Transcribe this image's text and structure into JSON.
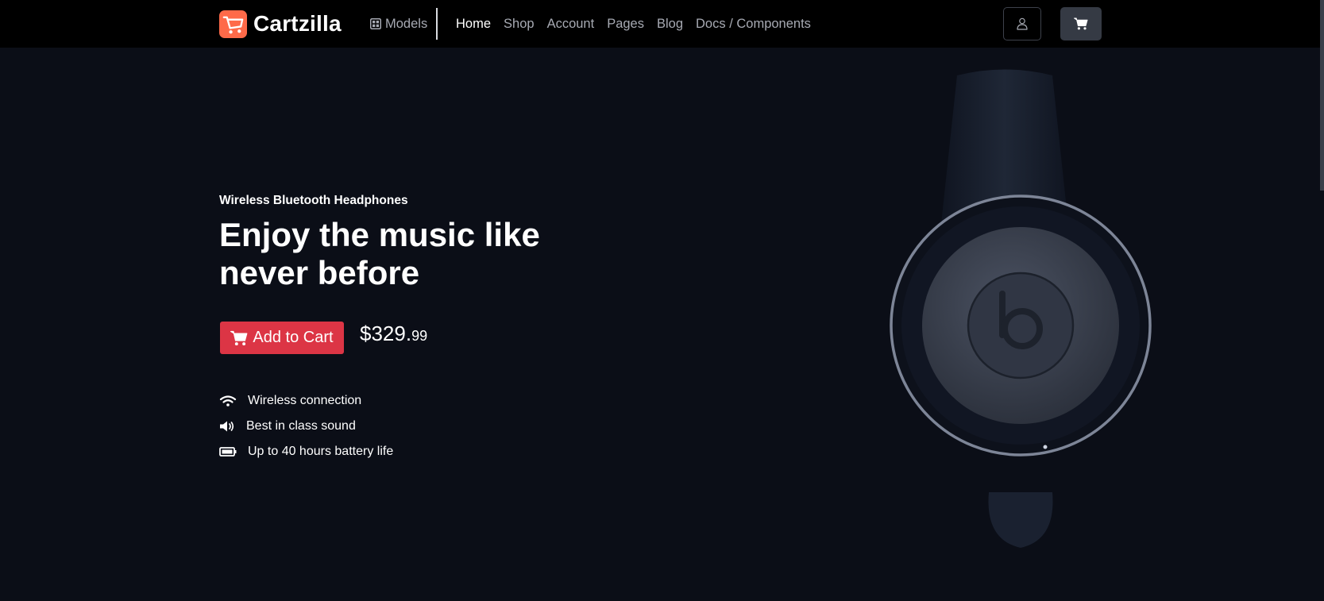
{
  "brand": {
    "name": "Cartzilla",
    "logo_icon": "cart-logo-icon",
    "accent": "#fe6a49"
  },
  "nav": {
    "models_label": "Models",
    "links": [
      {
        "label": "Home",
        "active": true
      },
      {
        "label": "Shop"
      },
      {
        "label": "Account"
      },
      {
        "label": "Pages"
      },
      {
        "label": "Blog"
      },
      {
        "label": "Docs / Components"
      }
    ],
    "account_icon": "user-icon",
    "cart_icon": "cart-icon"
  },
  "hero": {
    "eyebrow": "Wireless Bluetooth Headphones",
    "headline": "Enjoy the music like never before",
    "cta_label": "Add to Cart",
    "price_main": "$329.",
    "price_cents": "99",
    "features": [
      {
        "icon": "wifi-icon",
        "label": "Wireless connection"
      },
      {
        "icon": "volume-icon",
        "label": "Best in class sound"
      },
      {
        "icon": "battery-icon",
        "label": "Up to 40 hours battery life"
      }
    ],
    "product_image": "headphones-image"
  },
  "colors": {
    "background": "#0b0e17",
    "navbar": "#000000",
    "cta": "#dc3545",
    "muted_text": "#a7aab3"
  }
}
